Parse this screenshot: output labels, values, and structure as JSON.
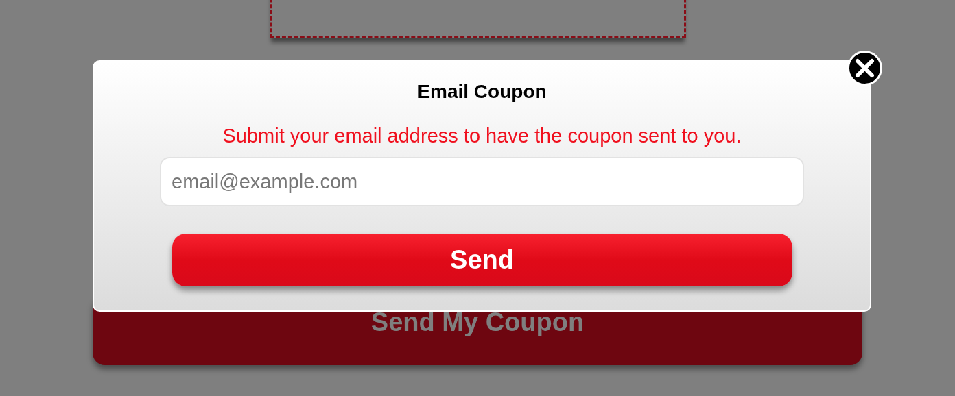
{
  "background_button": {
    "label": "Send My Coupon"
  },
  "dialog": {
    "title": "Email Coupon",
    "message": "Submit your email address to have the coupon sent to you.",
    "email_field": {
      "placeholder": "email@example.com"
    },
    "send_button": {
      "label": "Send"
    }
  }
}
